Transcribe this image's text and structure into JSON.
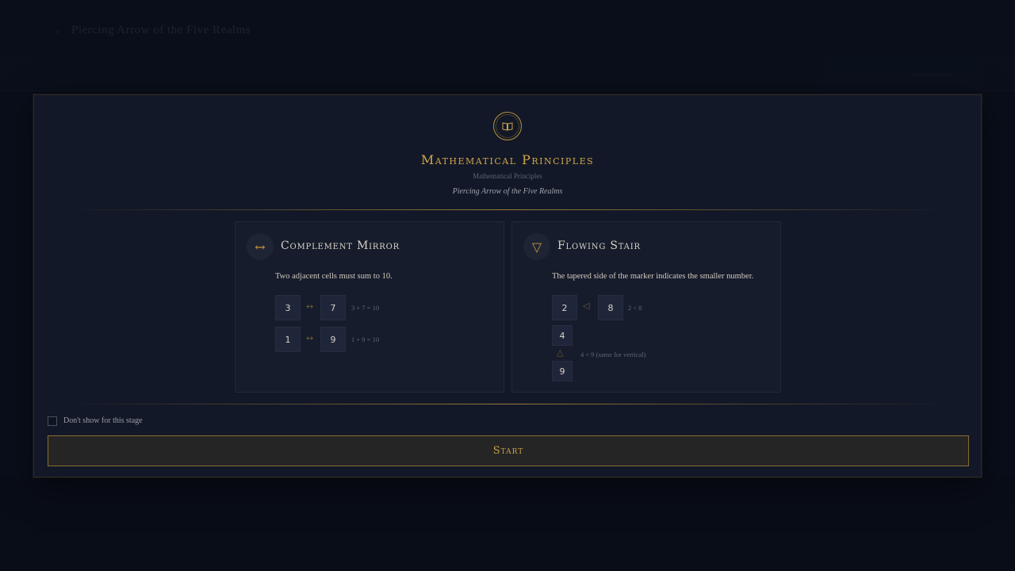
{
  "background": {
    "title": "Piercing Arrow of the Five Realms",
    "back_glyph": "‹",
    "right_label": "— — — —"
  },
  "modal": {
    "title": "Mathematical Principles",
    "subtitle": "Mathematical Principles",
    "tagline": "Piercing Arrow of the Five Realms",
    "crest_icon": "book-icon",
    "accent": "#d3a64a"
  },
  "cards": [
    {
      "title": "Complement Mirror",
      "icon_glyph": "↔",
      "description": "Two adjacent cells must sum to 10.",
      "examples": [
        {
          "a": "3",
          "op": "↔",
          "b": "7",
          "note": "3 + 7 = 10"
        },
        {
          "a": "1",
          "op": "↔",
          "b": "9",
          "note": "1 + 9 = 10"
        }
      ]
    },
    {
      "title": "Flowing Stair",
      "icon_glyph": "▽",
      "description": "The tapered side of the marker indicates the smaller number.",
      "horizontal": {
        "a": "2",
        "op": "◁",
        "b": "8",
        "note": "2 < 8"
      },
      "vertical": {
        "a": "4",
        "op": "△",
        "b": "9",
        "note": "4 < 9 (same for vertical)"
      }
    }
  ],
  "footer": {
    "checkbox_label": "Don't show for this stage",
    "checkbox_checked": false,
    "start_label": "Start"
  }
}
